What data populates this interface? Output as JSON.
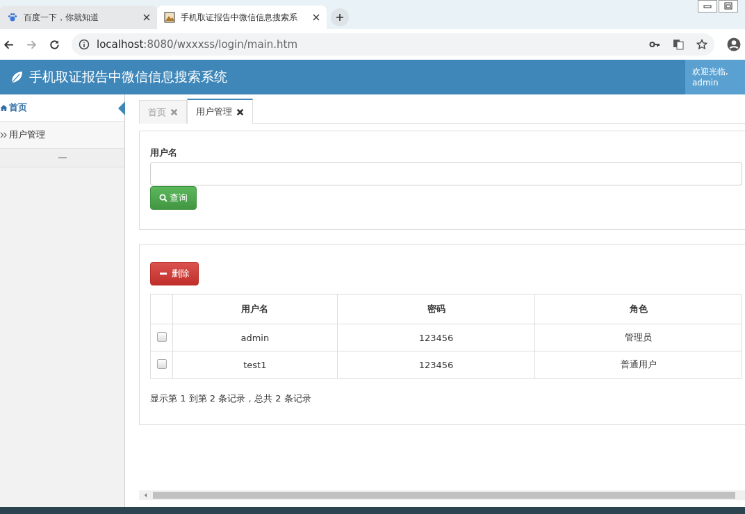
{
  "browser": {
    "tabs": [
      {
        "title": "百度一下，你就知道",
        "kind": "paw",
        "selected": false
      },
      {
        "title": "手机取证报告中微信信息搜索系",
        "kind": "image",
        "selected": true
      }
    ],
    "url_host": "localhost",
    "url_path": ":8080/wxxxss/login/main.htm"
  },
  "header": {
    "title": "手机取证报告中微信信息搜索系统",
    "welcome": "欢迎光临,",
    "user": "admin"
  },
  "sidebar": {
    "items": [
      {
        "label": "首页",
        "kind": "home",
        "selected": true
      },
      {
        "label": "用户管理",
        "kind": "chevrons",
        "selected": false
      }
    ]
  },
  "content_tabs": [
    {
      "label": "首页",
      "selected": false
    },
    {
      "label": "用户管理",
      "selected": true
    }
  ],
  "search": {
    "label": "用户名",
    "button": "查询"
  },
  "delete_button": "删除",
  "table": {
    "columns": [
      "用户名",
      "密码",
      "角色"
    ],
    "rows": [
      {
        "checked": false,
        "cells": [
          "admin",
          "123456",
          "管理员"
        ]
      },
      {
        "checked": false,
        "cells": [
          "test1",
          "123456",
          "普通用户"
        ]
      }
    ]
  },
  "pagination": "显示第 1 到第 2 条记录，总共 2 条记录"
}
